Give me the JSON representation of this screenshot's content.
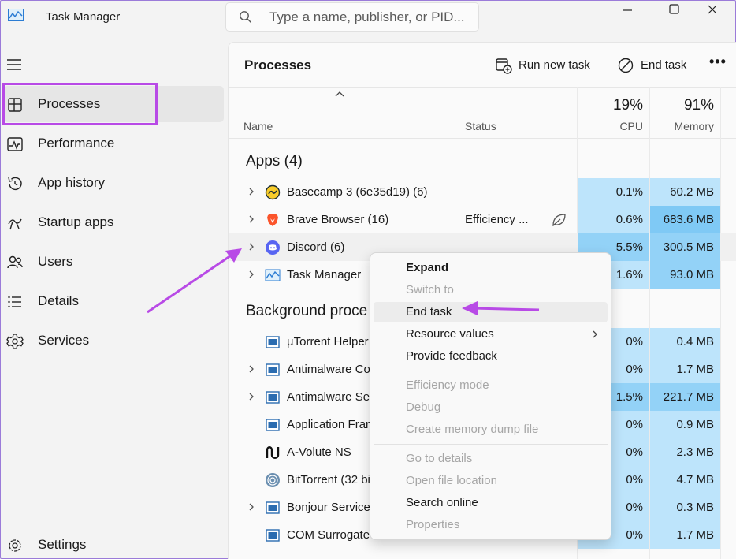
{
  "app": {
    "title": "Task Manager"
  },
  "search": {
    "placeholder": "Type a name, publisher, or PID..."
  },
  "sidebar": {
    "items": [
      {
        "label": "Processes",
        "icon": "processes-icon",
        "active": true
      },
      {
        "label": "Performance",
        "icon": "performance-icon"
      },
      {
        "label": "App history",
        "icon": "history-icon"
      },
      {
        "label": "Startup apps",
        "icon": "startup-icon"
      },
      {
        "label": "Users",
        "icon": "users-icon"
      },
      {
        "label": "Details",
        "icon": "details-icon"
      },
      {
        "label": "Services",
        "icon": "services-icon"
      }
    ],
    "settings_label": "Settings"
  },
  "main": {
    "title": "Processes",
    "run_new_task_label": "Run new task",
    "end_task_label": "End task",
    "more_label": "•••"
  },
  "table": {
    "columns": {
      "name": "Name",
      "status": "Status",
      "cpu": {
        "label": "CPU",
        "total": "19%"
      },
      "memory": {
        "label": "Memory",
        "total": "91%"
      }
    },
    "apps_title": "Apps (4)",
    "background_title": "Background proce",
    "apps": [
      {
        "name": "Basecamp 3 (6e35d19) (6)",
        "status": "",
        "cpu": "0.1%",
        "memory": "60.2 MB",
        "icon": "basecamp-icon"
      },
      {
        "name": "Brave Browser (16)",
        "status": "Efficiency ...",
        "cpu": "0.6%",
        "memory": "683.6 MB",
        "icon": "brave-icon"
      },
      {
        "name": "Discord (6)",
        "status": "",
        "cpu": "5.5%",
        "memory": "300.5 MB",
        "icon": "discord-icon"
      },
      {
        "name": "Task Manager",
        "status": "",
        "cpu": "1.6%",
        "memory": "93.0 MB",
        "icon": "taskmanager-icon"
      }
    ],
    "background": [
      {
        "name": "µTorrent Helper",
        "cpu": "0%",
        "memory": "0.4 MB",
        "expandable": false,
        "icon": "app-window-icon"
      },
      {
        "name": "Antimalware Co",
        "cpu": "0%",
        "memory": "1.7 MB",
        "expandable": true,
        "icon": "app-window-icon"
      },
      {
        "name": "Antimalware Se",
        "cpu": "1.5%",
        "memory": "221.7 MB",
        "expandable": true,
        "icon": "app-window-icon"
      },
      {
        "name": "Application Fran",
        "cpu": "0%",
        "memory": "0.9 MB",
        "expandable": false,
        "icon": "app-window-icon"
      },
      {
        "name": "A-Volute NS",
        "cpu": "0%",
        "memory": "2.3 MB",
        "expandable": false,
        "icon": "avolute-icon"
      },
      {
        "name": "BitTorrent (32 bi",
        "cpu": "0%",
        "memory": "4.7 MB",
        "expandable": false,
        "icon": "bittorrent-icon"
      },
      {
        "name": "Bonjour Service",
        "cpu": "0%",
        "memory": "0.3 MB",
        "expandable": true,
        "icon": "app-window-icon"
      },
      {
        "name": "COM Surrogate",
        "cpu": "0%",
        "memory": "1.7 MB",
        "expandable": false,
        "icon": "app-window-icon"
      }
    ]
  },
  "context_menu": {
    "items": [
      {
        "label": "Expand",
        "bold": true,
        "disabled": false
      },
      {
        "label": "Switch to",
        "disabled": true
      },
      {
        "label": "End task",
        "disabled": false,
        "selected": true
      },
      {
        "label": "Resource values",
        "disabled": false,
        "submenu": true
      },
      {
        "label": "Provide feedback",
        "disabled": false
      },
      {
        "label": "Efficiency mode",
        "disabled": true
      },
      {
        "label": "Debug",
        "disabled": true
      },
      {
        "label": "Create memory dump file",
        "disabled": true
      },
      {
        "label": "Go to details",
        "disabled": true
      },
      {
        "label": "Open file location",
        "disabled": true
      },
      {
        "label": "Search online",
        "disabled": false
      },
      {
        "label": "Properties",
        "disabled": true
      }
    ]
  },
  "colors": {
    "accent_annotation": "#b84ae6",
    "cell_light": "#bde4fb",
    "cell_medium": "#93d2f7",
    "cell_strong": "#7fc9f5"
  }
}
